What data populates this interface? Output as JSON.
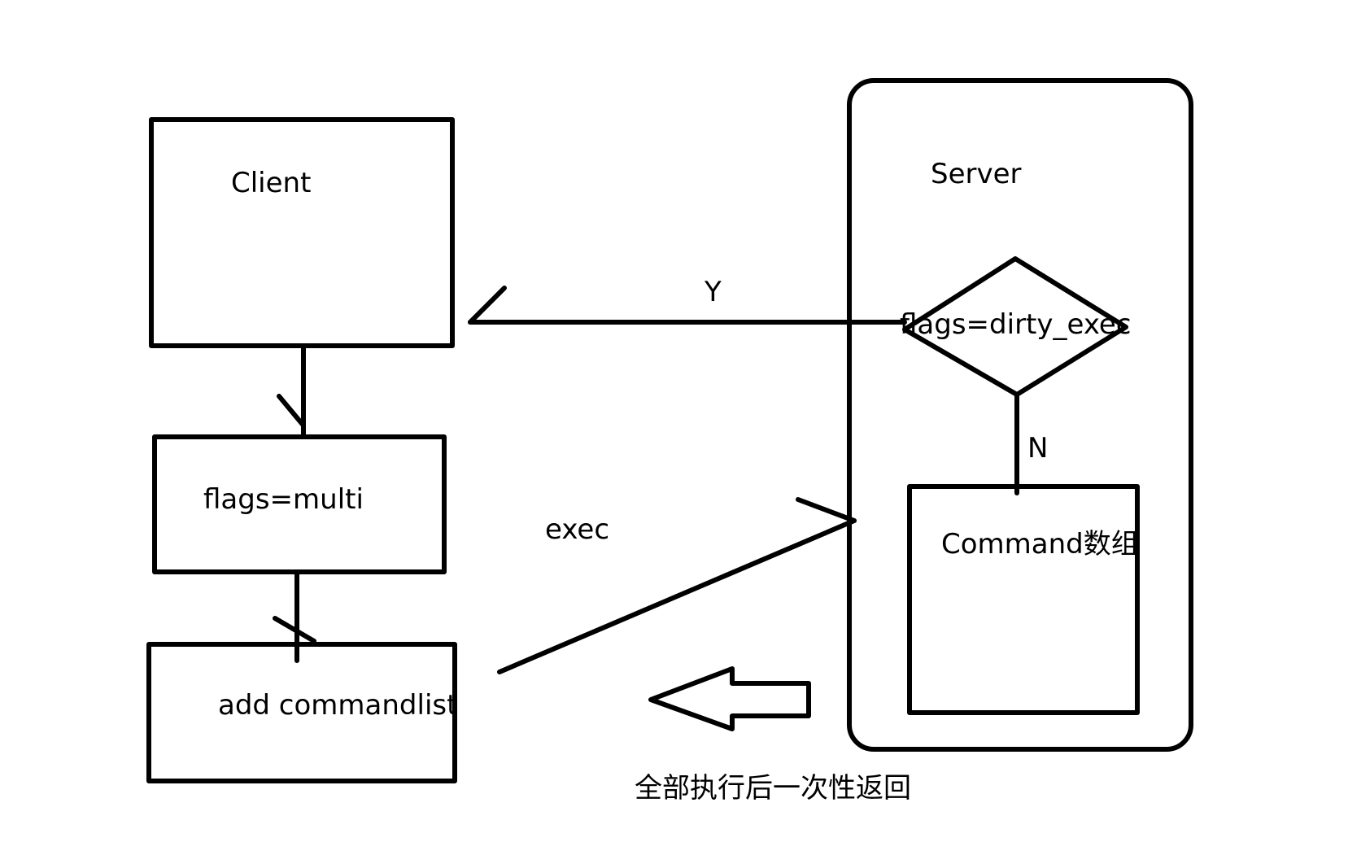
{
  "colors": {
    "stroke": "#000000",
    "text": "#000000",
    "background": "#ffffff"
  },
  "nodes": {
    "client": "Client",
    "multi": "flags=multi",
    "commandlist": "add commandlist",
    "server": "Server",
    "decision": "flags=dirty_exec",
    "commands": "Command数组"
  },
  "edges": {
    "exec": "exec",
    "yes": "Y",
    "no": "N",
    "return_note": "全部执行后一次性返回"
  }
}
